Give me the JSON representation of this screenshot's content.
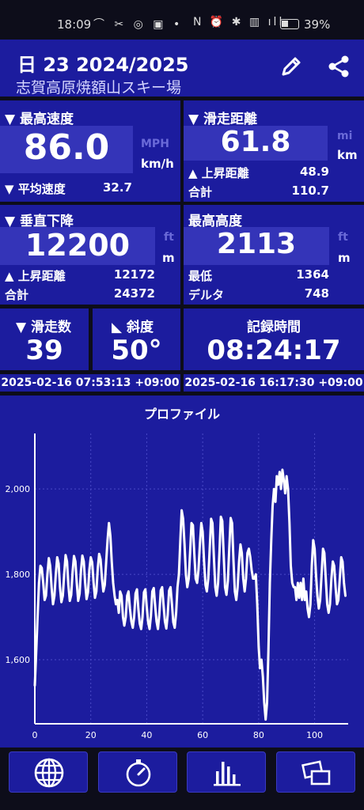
{
  "status": {
    "time": "18:09",
    "battery": "39%"
  },
  "header": {
    "title": "日 23 2024/2025",
    "subtitle": "志賀高原焼額山スキー場"
  },
  "max_speed": {
    "label": "▼ 最高速度",
    "value": "86.0",
    "unit_alt": "MPH",
    "unit": "km/h",
    "avg_label": "▼ 平均速度",
    "avg_value": "32.7"
  },
  "distance": {
    "label": "▼ 滑走距離",
    "value": "61.8",
    "unit_alt": "mi",
    "unit": "km",
    "ascent_label": "▲ 上昇距離",
    "ascent_value": "48.9",
    "total_label": "合計",
    "total_value": "110.7"
  },
  "descent": {
    "label": "▼ 垂直下降",
    "value": "12200",
    "unit_alt": "ft",
    "unit": "m",
    "ascent_label": "▲ 上昇距離",
    "ascent_value": "12172",
    "total_label": "合計",
    "total_value": "24372"
  },
  "altitude": {
    "label": "最高高度",
    "value": "2113",
    "unit_alt": "ft",
    "unit": "m",
    "min_label": "最低",
    "min_value": "1364",
    "delta_label": "デルタ",
    "delta_value": "748"
  },
  "runs": {
    "label": "▼ 滑走数",
    "value": "39"
  },
  "slope": {
    "label": "◣ 斜度",
    "value": "50°"
  },
  "record": {
    "label": "記録時間",
    "value": "08:24:17"
  },
  "dates": {
    "start": "2025-02-16 07:53:13 +09:00",
    "end": "2025-02-16 16:17:30 +09:00"
  },
  "chart_data": {
    "type": "line",
    "title": "プロファイル",
    "xlabel": "",
    "ylabel": "",
    "xlim": [
      0,
      112
    ],
    "ylim": [
      1450,
      2130
    ],
    "xticks": [
      0,
      20,
      40,
      60,
      80,
      100
    ],
    "yticks": [
      1600,
      1800,
      2000
    ],
    "ytick_labels": [
      "1,600",
      "1,800",
      "2,000"
    ],
    "grid": true,
    "color": "#ffffff",
    "series": [
      {
        "name": "",
        "x": [
          0,
          0.5,
          1,
          1.5,
          2,
          2.5,
          3,
          3.5,
          4,
          4.5,
          5,
          5.5,
          6,
          6.5,
          7,
          7.5,
          8,
          8.5,
          9,
          9.5,
          10,
          10.5,
          11,
          11.5,
          12,
          12.5,
          13,
          13.5,
          14,
          14.5,
          15,
          15.5,
          16,
          16.5,
          17,
          17.5,
          18,
          18.5,
          19,
          19.5,
          20,
          20.5,
          21,
          21.5,
          22,
          22.5,
          23,
          23.5,
          24,
          24.5,
          25,
          25.5,
          26,
          26.5,
          27,
          27.5,
          28,
          28.5,
          29,
          29.5,
          30,
          30.5,
          31,
          31.5,
          32,
          32.5,
          33,
          33.5,
          34,
          34.5,
          35,
          35.5,
          36,
          36.5,
          37,
          37.5,
          38,
          38.5,
          39,
          39.5,
          40,
          40.5,
          41,
          41.5,
          42,
          42.5,
          43,
          43.5,
          44,
          44.5,
          45,
          45.5,
          46,
          46.5,
          47,
          47.5,
          48,
          48.5,
          49,
          49.5,
          50,
          50.5,
          51,
          51.5,
          52,
          52.5,
          53,
          53.5,
          54,
          54.5,
          55,
          55.5,
          56,
          56.5,
          57,
          57.5,
          58,
          58.5,
          59,
          59.5,
          60,
          60.5,
          61,
          61.5,
          62,
          62.5,
          63,
          63.5,
          64,
          64.5,
          65,
          65.5,
          66,
          66.5,
          67,
          67.5,
          68,
          68.5,
          69,
          69.5,
          70,
          70.5,
          71,
          71.5,
          72,
          72.5,
          73,
          73.5,
          74,
          74.5,
          75,
          75.5,
          76,
          76.5,
          77,
          77.5,
          78,
          78.5,
          79,
          79.5,
          80,
          80.5,
          81,
          81.5,
          82,
          82.5,
          83,
          83.5,
          84,
          84.5,
          85,
          85.5,
          86,
          86.5,
          87,
          87.5,
          88,
          88.5,
          89,
          89.5,
          90,
          90.5,
          91,
          91.5,
          92,
          92.5,
          93,
          93.5,
          94,
          94.5,
          95,
          95.5,
          96,
          96.5,
          97,
          97.5,
          98,
          98.5,
          99,
          99.5,
          100,
          100.5,
          101,
          101.5,
          102,
          102.5,
          103,
          103.5,
          104,
          104.5,
          105,
          105.5,
          106,
          106.5,
          107,
          107.5,
          108,
          108.5,
          109,
          109.5,
          110,
          110.5,
          111
        ],
        "y": [
          1540,
          1620,
          1700,
          1780,
          1820,
          1815,
          1780,
          1740,
          1750,
          1800,
          1838,
          1820,
          1770,
          1730,
          1750,
          1800,
          1840,
          1825,
          1770,
          1735,
          1750,
          1800,
          1845,
          1830,
          1775,
          1738,
          1752,
          1805,
          1843,
          1830,
          1780,
          1738,
          1755,
          1808,
          1844,
          1830,
          1780,
          1742,
          1758,
          1810,
          1840,
          1828,
          1780,
          1745,
          1760,
          1815,
          1848,
          1835,
          1790,
          1760,
          1775,
          1830,
          1880,
          1920,
          1890,
          1830,
          1780,
          1750,
          1730,
          1740,
          1710,
          1760,
          1750,
          1700,
          1680,
          1700,
          1750,
          1760,
          1720,
          1690,
          1675,
          1700,
          1755,
          1765,
          1720,
          1685,
          1672,
          1700,
          1758,
          1765,
          1725,
          1688,
          1672,
          1702,
          1760,
          1768,
          1728,
          1690,
          1672,
          1705,
          1762,
          1770,
          1730,
          1690,
          1673,
          1705,
          1762,
          1770,
          1730,
          1688,
          1675,
          1710,
          1770,
          1800,
          1880,
          1950,
          1930,
          1870,
          1800,
          1770,
          1790,
          1850,
          1920,
          1915,
          1850,
          1790,
          1780,
          1810,
          1870,
          1920,
          1900,
          1830,
          1775,
          1760,
          1790,
          1860,
          1930,
          1920,
          1840,
          1770,
          1750,
          1780,
          1855,
          1935,
          1925,
          1845,
          1770,
          1752,
          1785,
          1860,
          1932,
          1920,
          1835,
          1760,
          1740,
          1770,
          1830,
          1870,
          1850,
          1790,
          1760,
          1790,
          1850,
          1860,
          1840,
          1810,
          1790,
          1790,
          1800,
          1730,
          1630,
          1580,
          1600,
          1560,
          1500,
          1460,
          1500,
          1620,
          1780,
          1880,
          1960,
          2000,
          1970,
          2030,
          2010,
          2040,
          2000,
          2045,
          2020,
          1990,
          2030,
          2000,
          1920,
          1820,
          1780,
          1770,
          1770,
          1740,
          1780,
          1745,
          1780,
          1740,
          1790,
          1740,
          1760,
          1720,
          1700,
          1730,
          1820,
          1880,
          1860,
          1800,
          1750,
          1720,
          1740,
          1800,
          1860,
          1850,
          1790,
          1730,
          1710,
          1730,
          1790,
          1830,
          1820,
          1770,
          1730,
          1740,
          1790,
          1840,
          1830,
          1780,
          1750
        ]
      }
    ]
  }
}
